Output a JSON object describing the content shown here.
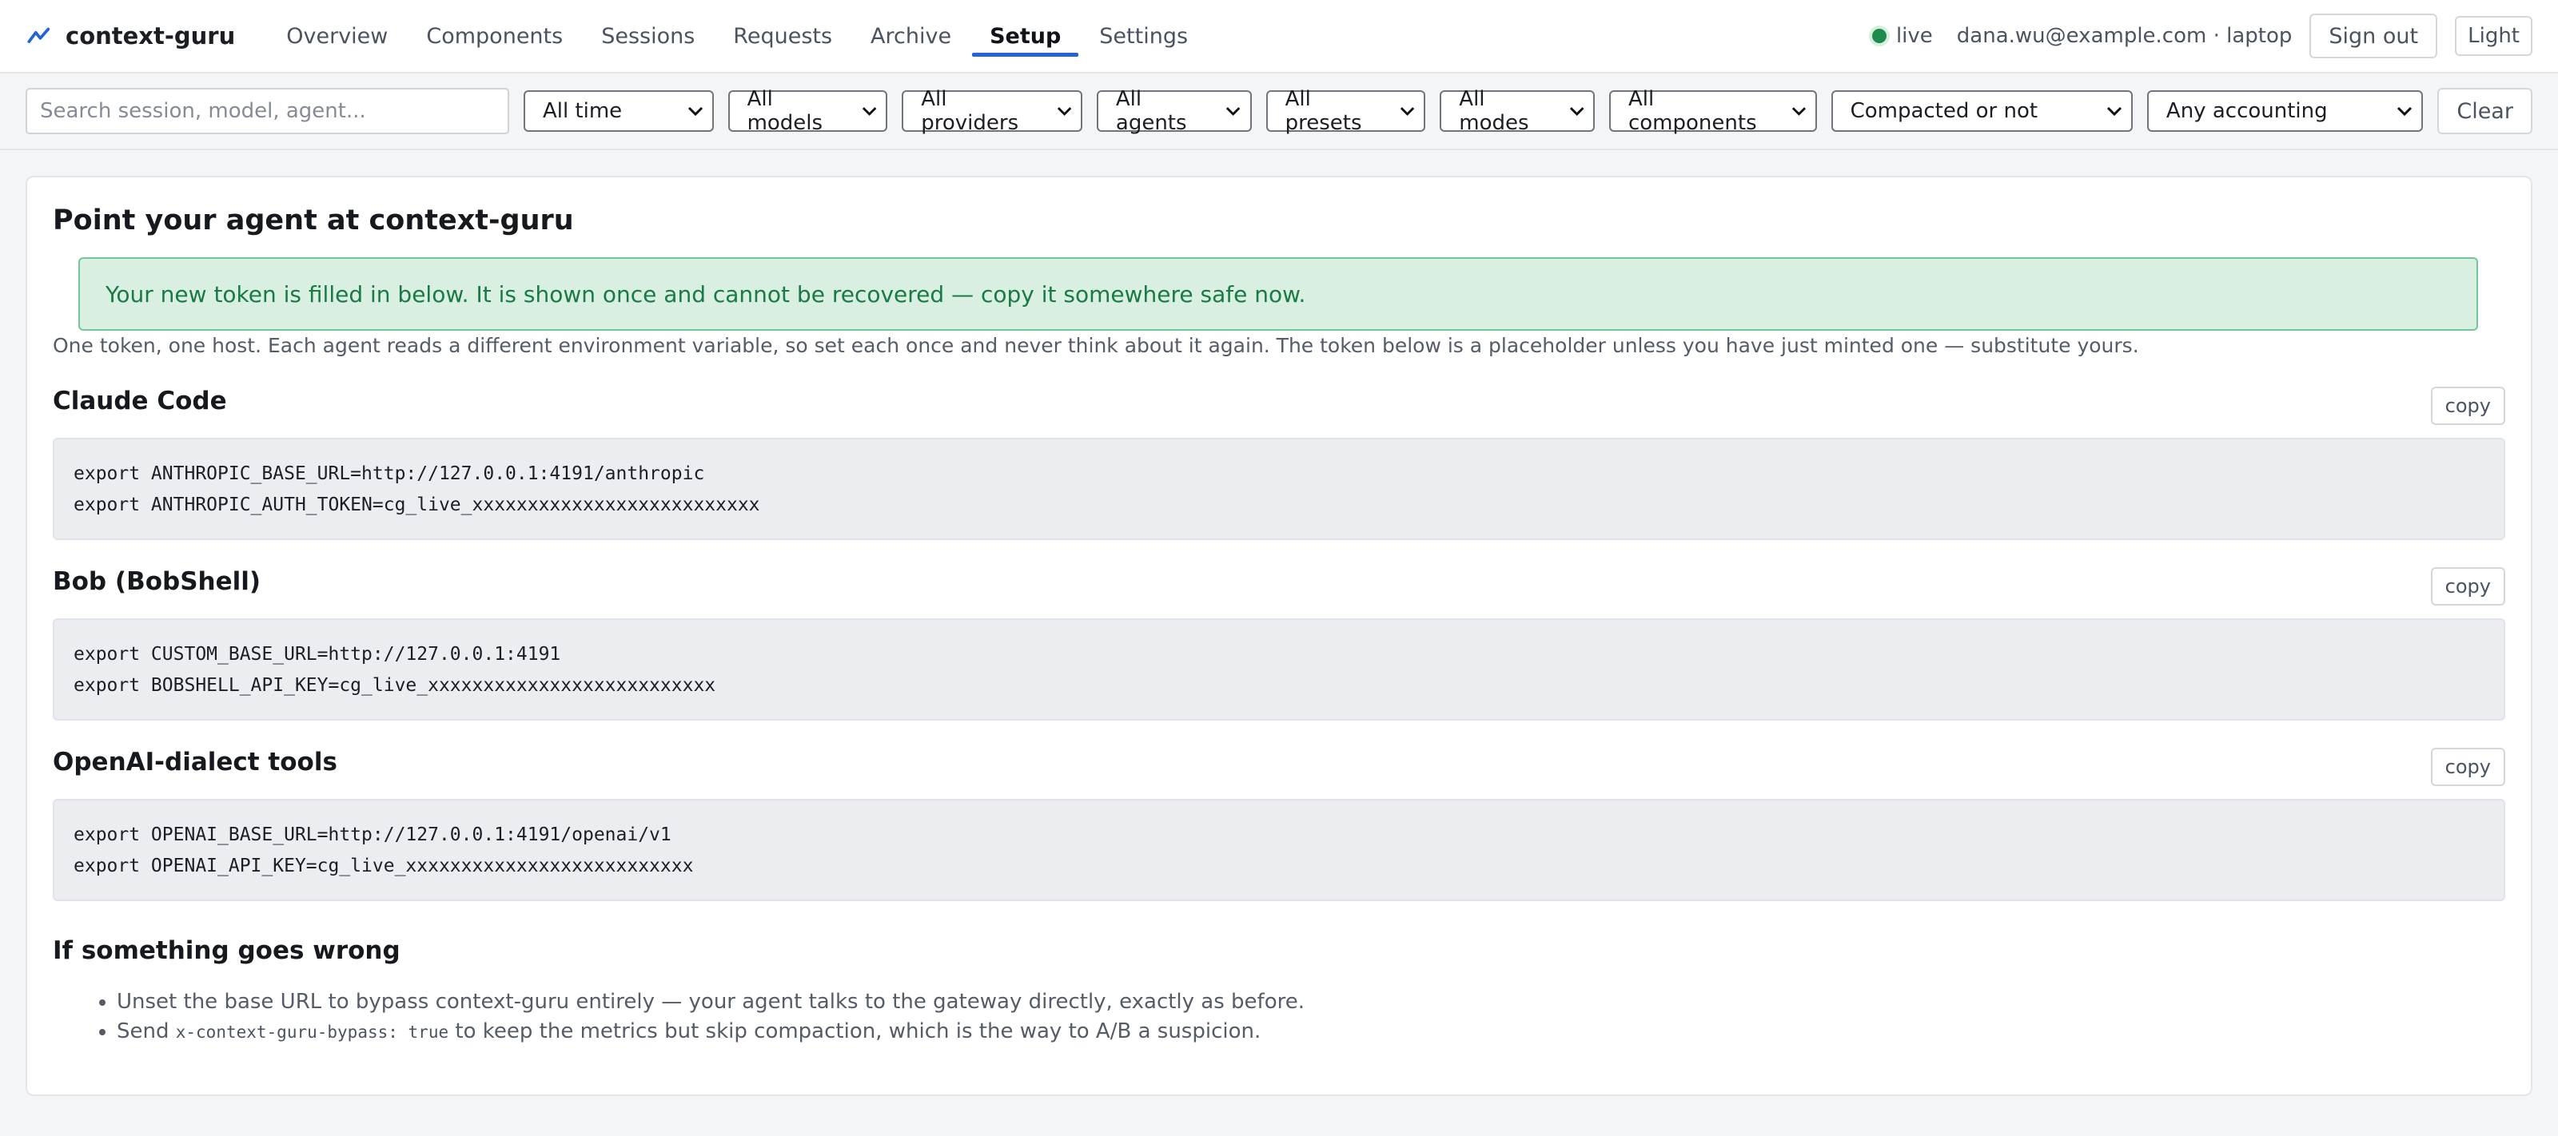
{
  "app": {
    "name": "context-guru",
    "icon": "pulse-chart-icon"
  },
  "nav": {
    "tabs": [
      {
        "label": "Overview",
        "active": false
      },
      {
        "label": "Components",
        "active": false
      },
      {
        "label": "Sessions",
        "active": false
      },
      {
        "label": "Requests",
        "active": false
      },
      {
        "label": "Archive",
        "active": false
      },
      {
        "label": "Setup",
        "active": true
      },
      {
        "label": "Settings",
        "active": false
      }
    ],
    "status": {
      "label": "live",
      "color": "#1f8a4c"
    },
    "user": "dana.wu@example.com · laptop",
    "signout_label": "Sign out",
    "theme_label": "Light",
    "accent_color": "#2463d4"
  },
  "filters": {
    "search_placeholder": "Search session, model, agent...",
    "time": "All time",
    "models": "All models",
    "providers": "All providers",
    "agents": "All agents",
    "presets": "All presets",
    "modes": "All modes",
    "components": "All components",
    "compaction": "Compacted or not",
    "accounting": "Any accounting",
    "clear_label": "Clear"
  },
  "setup": {
    "title": "Point your agent at context-guru",
    "notice": "Your new token is filled in below. It is shown once and cannot be recovered — copy it somewhere safe now.",
    "intro": "One token, one host. Each agent reads a different environment variable, so set each once and never think about it again. The token below is a placeholder unless you have just minted one — substitute yours.",
    "copy_label": "copy",
    "sections": [
      {
        "title": "Claude Code",
        "lines": [
          "export ANTHROPIC_BASE_URL=http://127.0.0.1:4191/anthropic",
          "export ANTHROPIC_AUTH_TOKEN=cg_live_xxxxxxxxxxxxxxxxxxxxxxxxxx"
        ]
      },
      {
        "title": "Bob (BobShell)",
        "lines": [
          "export CUSTOM_BASE_URL=http://127.0.0.1:4191",
          "export BOBSHELL_API_KEY=cg_live_xxxxxxxxxxxxxxxxxxxxxxxxxx"
        ]
      },
      {
        "title": "OpenAI-dialect tools",
        "lines": [
          "export OPENAI_BASE_URL=http://127.0.0.1:4191/openai/v1",
          "export OPENAI_API_KEY=cg_live_xxxxxxxxxxxxxxxxxxxxxxxxxx"
        ]
      }
    ],
    "troubleshoot": {
      "title": "If something goes wrong",
      "item1": "Unset the base URL to bypass context-guru entirely — your agent talks to the gateway directly, exactly as before.",
      "item2_prefix": "Send ",
      "item2_code": "x-context-guru-bypass: true",
      "item2_suffix": " to keep the metrics but skip compaction, which is the way to A/B a suspicion."
    }
  }
}
